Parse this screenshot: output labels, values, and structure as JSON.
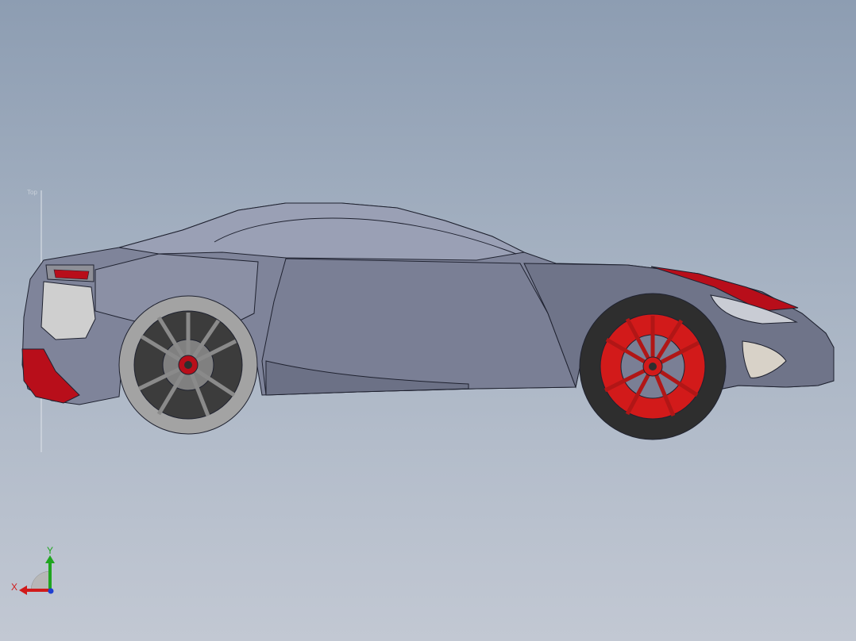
{
  "viewport": {
    "background_top": "#8d9db2",
    "background_bottom": "#c2c8d3"
  },
  "model": {
    "body_color": "#7f849a",
    "body_shadow_color": "#5f6478",
    "accent_color": "#b80e1a",
    "front_rim_color": "#d21a1a",
    "rear_rim_color": "#3c3c3c",
    "tire_color": "#2e2e2e",
    "rear_tire_color": "#a3a3a3",
    "outline_color": "#1f2230"
  },
  "sketch_origin": {
    "label": "Top"
  },
  "triad": {
    "y_label": "Y",
    "x_label": "X",
    "y_color": "#1fa51f",
    "x_color": "#d11a1a",
    "z_color": "#1f3fd1",
    "y_icon": "y-axis-arrow-icon",
    "x_icon": "x-axis-arrow-icon",
    "z_icon": "z-axis-dot-icon"
  }
}
